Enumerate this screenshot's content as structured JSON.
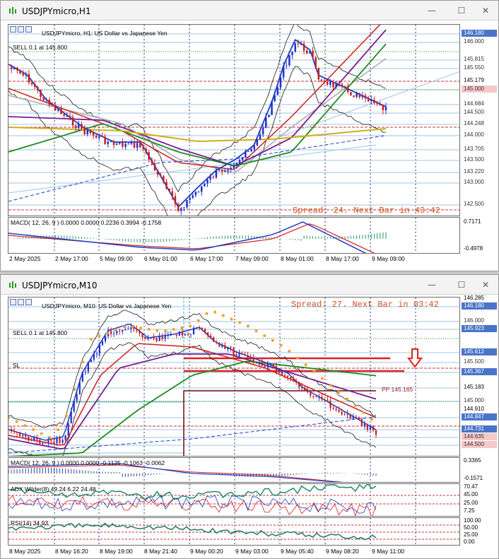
{
  "h1": {
    "window_title": "USDJPYmicro,H1",
    "chart_caption": "USDJPYmicro, H1:  US Dollar vs Japanese Yen",
    "sell_label": "SELL 0.1 at 145.800",
    "spread_text": "Spread: 24. Next Bar in 43:42",
    "macd_label": "MACD( 12, 26, 9 ) 0.0000 0.0000 0.2236 0.3994 -0.1758",
    "price_labels": [
      "146.180",
      "146.000",
      "145.815",
      "145.550",
      "145.179",
      "145.000",
      "144.684",
      "144.500",
      "144.248",
      "144.000",
      "143.705",
      "143.500",
      "143.220",
      "143.000",
      "142.500"
    ],
    "macd_scale": [
      "0.7171",
      "-0.4978"
    ],
    "time_labels": [
      "2 May 2025",
      "2 May 17:00",
      "5 May 09:00",
      "6 May 01:00",
      "6 May 17:00",
      "7 May 09:00",
      "8 May 01:00",
      "8 May 17:00",
      "9 May 09:00"
    ]
  },
  "m10": {
    "window_title": "USDJPYmicro,M10",
    "chart_caption": "USDJPYmicro, M10:  US Dollar vs Japanese Yen",
    "sell_label": "SELL 0.1 at 145.800",
    "sl_label": "SL",
    "pp_label": "PP 145.165",
    "spread_text": "Spread: 27. Next Bar in 03:42",
    "macd_label": "MACD( 12, 26, 9 ) 0.0000 0.0000 -0.1125 -0.1063 -0.0062",
    "adx_label": "ADX Wilder(8) 49.24 6.22 24.48",
    "rsi_label": "RSI(14) 34.93",
    "price_labels": [
      "146.285",
      "146.180",
      "146.000",
      "145.923",
      "145.612",
      "145.500",
      "145.367",
      "145.183",
      "145.000",
      "144.910",
      "144.847",
      "144.731",
      "144.635",
      "144.500"
    ],
    "macd_scale": [
      "0.3365",
      "-0.1571"
    ],
    "adx_scale": [
      "70.47",
      "45.00",
      "25.00",
      "7.25"
    ],
    "rsi_scale": [
      "100.00",
      "50.00",
      "25.00",
      "0.00"
    ],
    "time_labels": [
      "8 May 2025",
      "8 May 16:20",
      "8 May 19:00",
      "8 May 21:40",
      "9 May 00:20",
      "9 May 03:00",
      "9 May 05:40",
      "9 May 08:20",
      "9 May 11:00"
    ]
  },
  "window_buttons": {
    "minimize": "—",
    "maximize": "☐",
    "close": "✕"
  },
  "colors": {
    "bull": "#1e32c8",
    "bear": "#c81e1e",
    "ma_red": "#d21e1e",
    "ma_purple": "#7a1e8c",
    "ma_green": "#1e8c1e",
    "ma_yellow": "#d2aa1e",
    "ma_blue": "#1e3cc8",
    "psar": "#f5a01e",
    "accent": "#4a74c9"
  }
}
